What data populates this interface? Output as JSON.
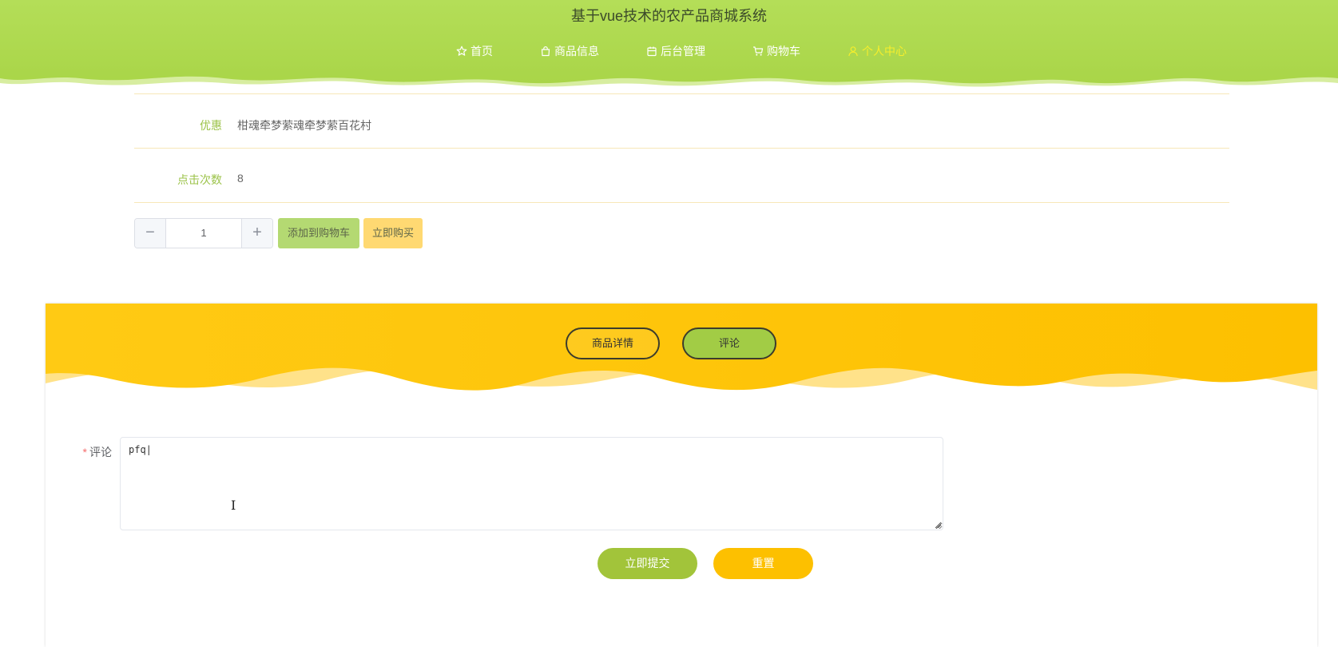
{
  "site": {
    "title": "基于vue技术的农产品商城系统"
  },
  "nav": [
    {
      "label": "首页",
      "icon": "star-icon"
    },
    {
      "label": "商品信息",
      "icon": "bag-icon"
    },
    {
      "label": "后台管理",
      "icon": "box-icon"
    },
    {
      "label": "购物车",
      "icon": "cart-icon"
    },
    {
      "label": "个人中心",
      "icon": "user-icon",
      "active": true
    }
  ],
  "details": [
    {
      "label": "优惠",
      "value": "柑魂牵梦萦魂牵梦萦百花村"
    },
    {
      "label": "点击次数",
      "value": "8"
    }
  ],
  "purchase": {
    "quantity": "1",
    "minus": "−",
    "plus": "+",
    "add_to_cart": "添加到购物车",
    "buy_now": "立即购买"
  },
  "tabs": [
    {
      "label": "商品详情"
    },
    {
      "label": "评论",
      "active": true
    }
  ],
  "comment_form": {
    "label": "评论",
    "required_mark": "*",
    "value": "pfq|",
    "submit": "立即提交",
    "reset": "重置"
  },
  "colors": {
    "header_green": "#b3dc5a",
    "panel_yellow": "#fec40a",
    "accent_green": "#a2c43a",
    "accent_yellow": "#fdc000",
    "active_nav": "#f6ee2c"
  }
}
